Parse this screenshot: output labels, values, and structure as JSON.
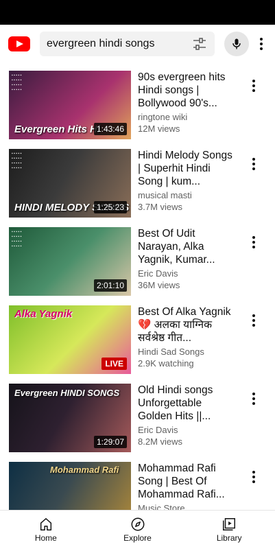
{
  "search": {
    "query": "evergreen hindi songs"
  },
  "videos": [
    {
      "thumb_text": "Evergreen Hits Hi",
      "badge": "1:43:46",
      "title": "90s evergreen hits Hindi songs | Bollywood 90's...",
      "channel": "ringtone wiki",
      "stats": "12M views",
      "bg": "#3a1c3f",
      "bg2": "#a8326e"
    },
    {
      "thumb_text": "HINDI MELODY SONGS",
      "badge": "1:25:23",
      "title": "Hindi Melody Songs | Superhit Hindi Song | kum...",
      "channel": "musical masti",
      "stats": "3.7M views",
      "bg": "#1d1d1d",
      "bg2": "#6b5a4a"
    },
    {
      "thumb_text": "",
      "badge": "2:01:10",
      "title": "Best Of Udit Narayan, Alka Yagnik, Kumar...",
      "channel": "Eric Davis",
      "stats": "36M views",
      "bg": "#1f5a3a",
      "bg2": "#4a8f6a"
    },
    {
      "thumb_text": "Alka Yagnik",
      "badge": "LIVE",
      "title": "Best Of Alka Yagnik 💔 अलका याग्निक सर्वश्रेष्ठ गीत...",
      "channel": "Hindi Sad Songs",
      "stats": "2.9K watching",
      "bg": "#7fbf2a",
      "bg2": "#d6e85a"
    },
    {
      "thumb_text": "Evergreen HINDI SONGS",
      "badge": "1:29:07",
      "title": "Old Hindi songs Unforgettable Golden Hits ||...",
      "channel": "Eric Davis",
      "stats": "8.2M views",
      "bg": "#15131a",
      "bg2": "#5a2a3a"
    },
    {
      "thumb_text": "Mohammad Rafi",
      "badge": "",
      "title": "Mohammad Rafi Song | Best Of Mohammad Rafi...",
      "channel": "Music Store",
      "stats": "",
      "bg": "#0e2f44",
      "bg2": "#b08a3a"
    }
  ],
  "nav": {
    "home": "Home",
    "explore": "Explore",
    "library": "Library"
  }
}
